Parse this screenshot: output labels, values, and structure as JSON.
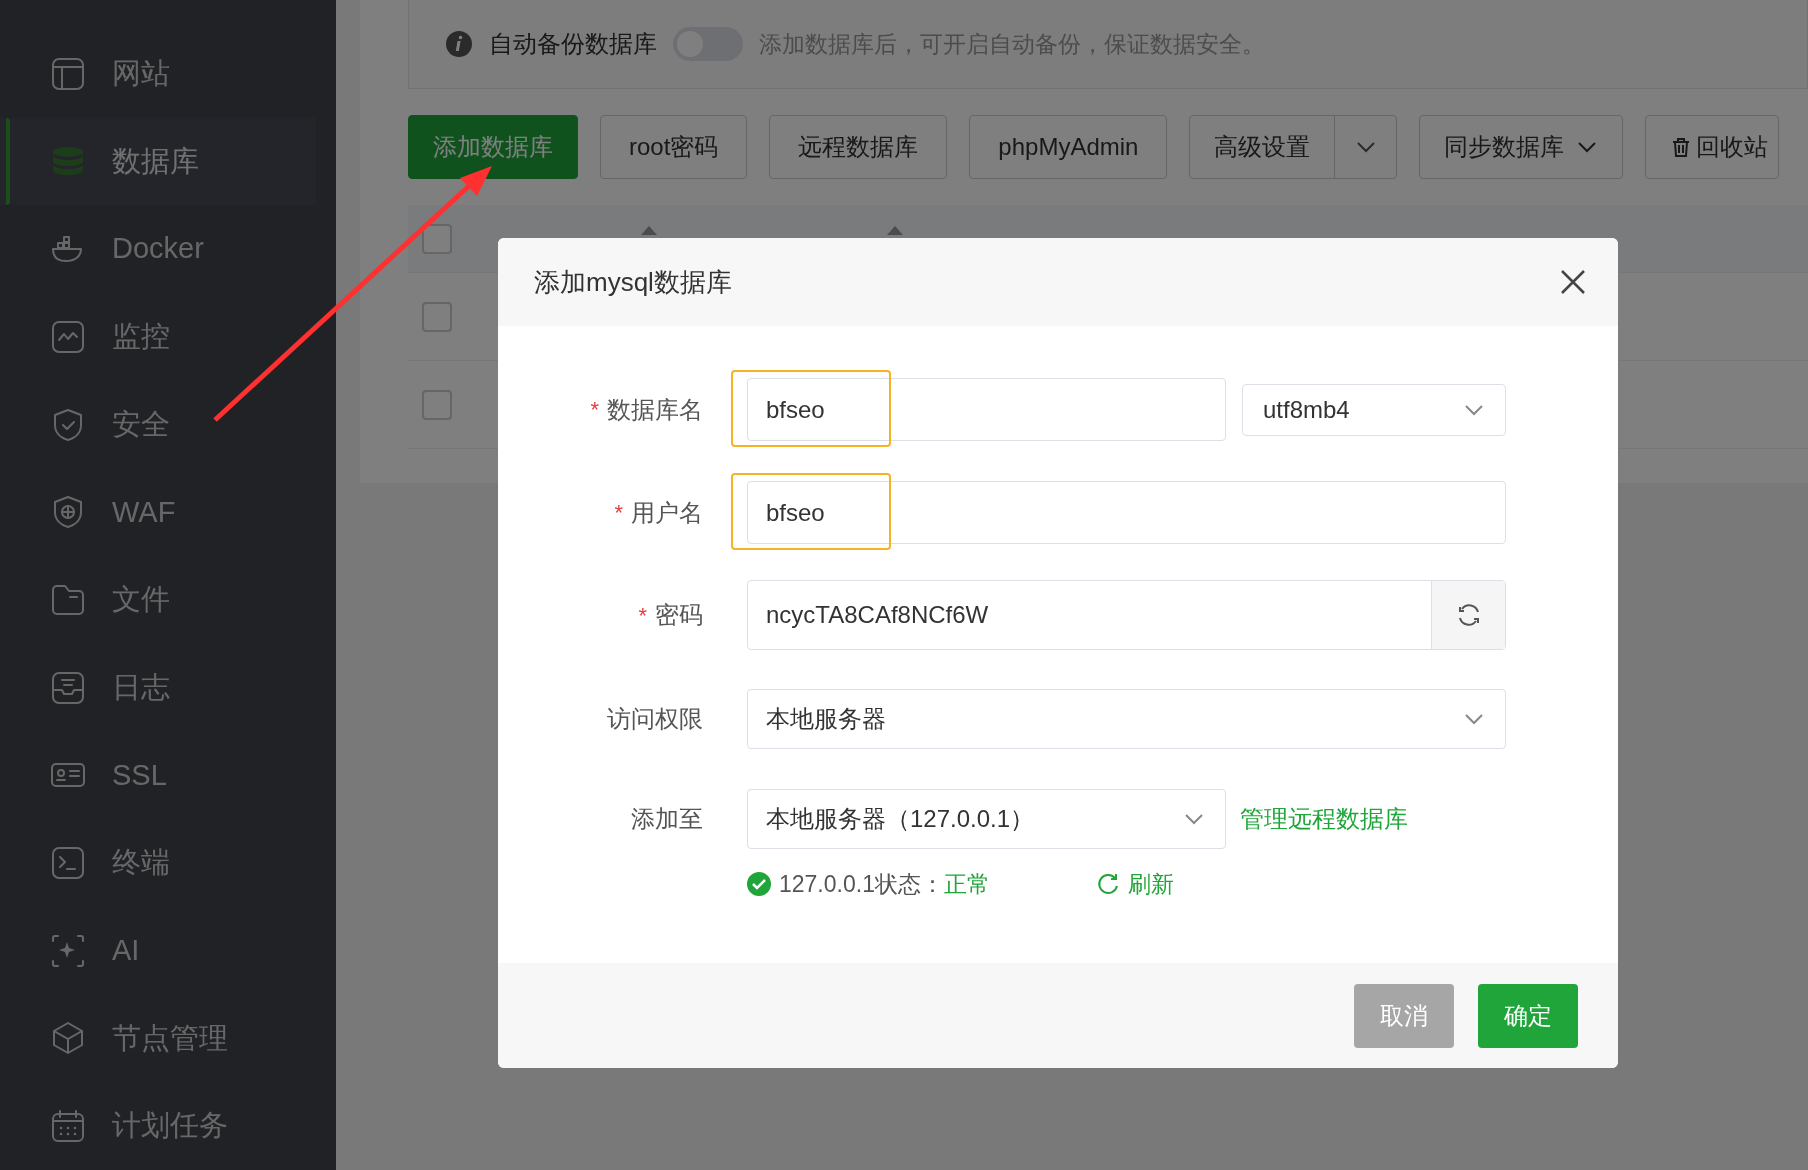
{
  "sidebar": {
    "items": [
      {
        "label": "网站",
        "selected": false
      },
      {
        "label": "数据库",
        "selected": true
      },
      {
        "label": "Docker",
        "selected": false
      },
      {
        "label": "监控",
        "selected": false
      },
      {
        "label": "安全",
        "selected": false
      },
      {
        "label": "WAF",
        "selected": false
      },
      {
        "label": "文件",
        "selected": false
      },
      {
        "label": "日志",
        "selected": false
      },
      {
        "label": "SSL",
        "selected": false
      },
      {
        "label": "终端",
        "selected": false
      },
      {
        "label": "AI",
        "selected": false
      },
      {
        "label": "节点管理",
        "selected": false
      },
      {
        "label": "计划任务",
        "selected": false
      }
    ]
  },
  "notice": {
    "label": "自动备份数据库",
    "on": false,
    "hint": "添加数据库后，可开启自动备份，保证数据安全。"
  },
  "toolbar": [
    {
      "label": "添加数据库",
      "kind": "primary"
    },
    {
      "label": "root密码",
      "kind": "plain"
    },
    {
      "label": "远程数据库",
      "kind": "plain"
    },
    {
      "label": "phpMyAdmin",
      "kind": "plain"
    },
    {
      "label": "高级设置",
      "kind": "split"
    },
    {
      "label": "同步数据库",
      "kind": "dropdown"
    },
    {
      "label": "回收站",
      "kind": "trash"
    }
  ],
  "table": {
    "header_checked": false,
    "rows": [
      {
        "checked": false
      },
      {
        "checked": false
      }
    ]
  },
  "dialog": {
    "title": "添加mysql数据库",
    "fields": [
      {
        "kind": "name_charset",
        "required_mark": "*",
        "label": "数据库名",
        "value": "bfseo",
        "highlighted": true,
        "select": "utf8mb4"
      },
      {
        "kind": "text",
        "required_mark": "*",
        "label": "用户名",
        "value": "bfseo",
        "highlighted": true
      },
      {
        "kind": "password",
        "required_mark": "*",
        "label": "密码",
        "value": "ncycTA8CAf8NCf6W"
      },
      {
        "kind": "select",
        "label": "访问权限",
        "value": "本地服务器"
      },
      {
        "kind": "select_link",
        "label": "添加至",
        "value": "本地服务器（127.0.0.1）",
        "link": "管理远程数据库"
      }
    ],
    "status": {
      "label": "127.0.0.1状态：",
      "value": "正常",
      "ok": true,
      "refresh": "刷新"
    },
    "buttons": [
      {
        "label": "取消",
        "kind": "cancel"
      },
      {
        "label": "确定",
        "kind": "confirm"
      }
    ]
  }
}
